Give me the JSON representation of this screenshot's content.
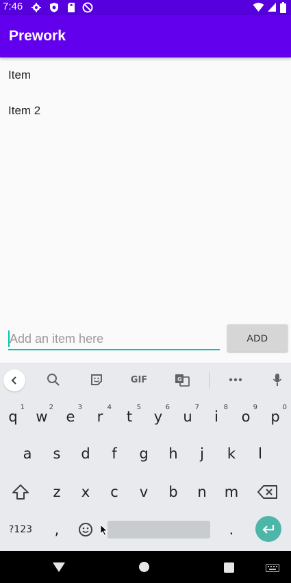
{
  "status_bar": {
    "time": "7:46",
    "icons": [
      "gear-icon",
      "shield-icon",
      "sd-card-icon",
      "no-disturb-icon"
    ],
    "right_icons": [
      "wifi-icon",
      "signal-icon",
      "battery-icon"
    ]
  },
  "app_bar": {
    "title": "Prework"
  },
  "list": {
    "items": [
      "Item",
      "Item 2"
    ]
  },
  "input": {
    "placeholder": "Add an item here",
    "value": ""
  },
  "add_button": {
    "label": "ADD"
  },
  "keyboard": {
    "toolbar": {
      "gif_label": "GIF"
    },
    "row1": [
      {
        "key": "q",
        "hint": "1"
      },
      {
        "key": "w",
        "hint": "2"
      },
      {
        "key": "e",
        "hint": "3"
      },
      {
        "key": "r",
        "hint": "4"
      },
      {
        "key": "t",
        "hint": "5"
      },
      {
        "key": "y",
        "hint": "6"
      },
      {
        "key": "u",
        "hint": "7"
      },
      {
        "key": "i",
        "hint": "8"
      },
      {
        "key": "o",
        "hint": "9"
      },
      {
        "key": "p",
        "hint": "0"
      }
    ],
    "row2": [
      "a",
      "s",
      "d",
      "f",
      "g",
      "h",
      "j",
      "k",
      "l"
    ],
    "row3": [
      "z",
      "x",
      "c",
      "v",
      "b",
      "n",
      "m"
    ],
    "symbols_label": "?123",
    "comma": ",",
    "period": "."
  },
  "colors": {
    "status_bar": "#5500dd",
    "app_bar": "#6200ee",
    "accent": "#03c4b0",
    "enter_key": "#4db6a8"
  }
}
